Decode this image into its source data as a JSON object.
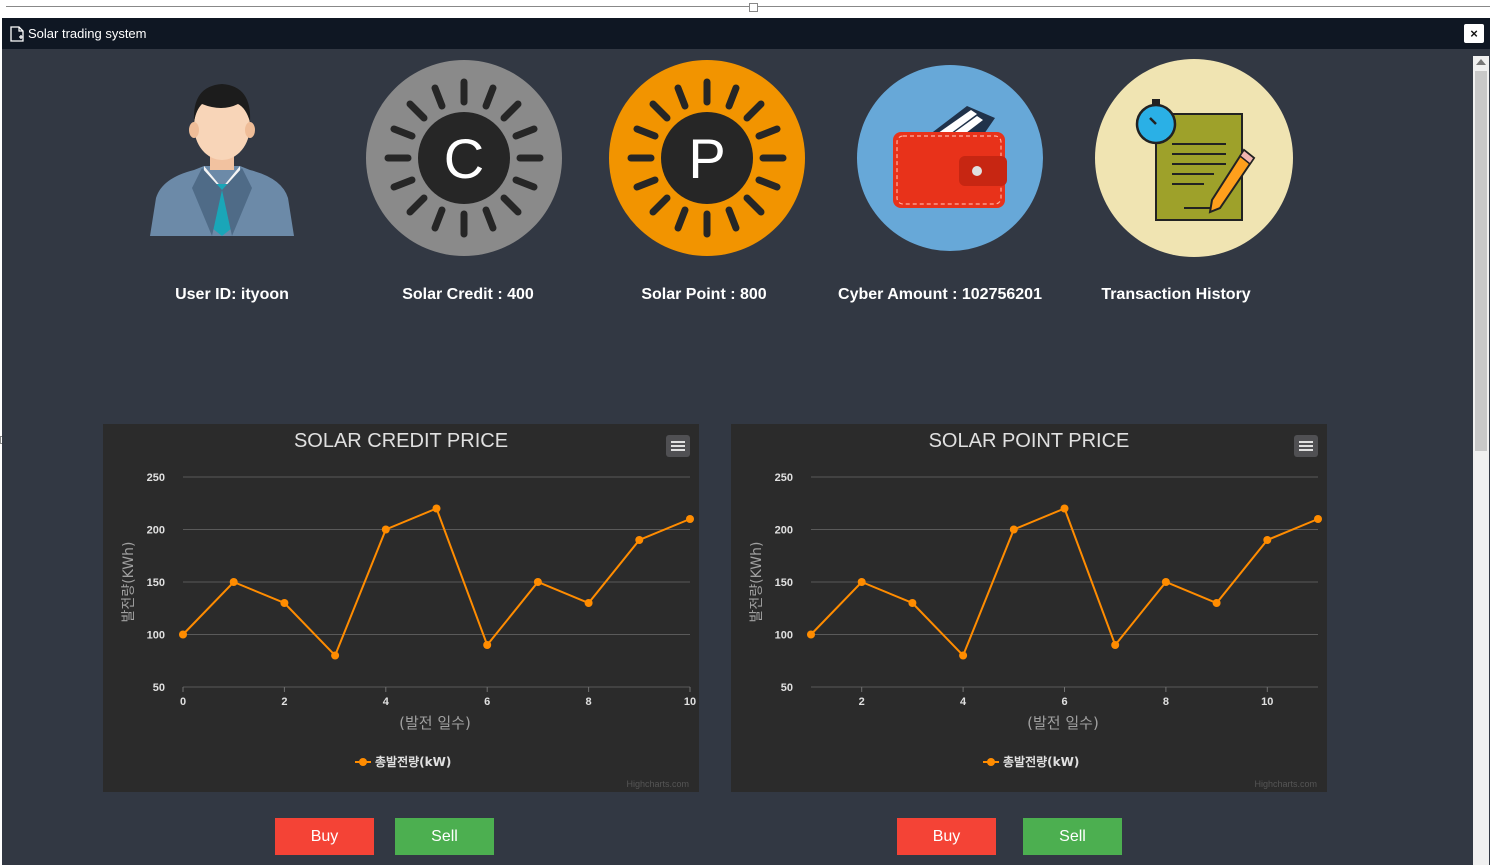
{
  "window": {
    "title": "Solar trading system",
    "close_label": "×"
  },
  "profile": [
    {
      "label": "User ID: ityoon",
      "icon": "user-avatar-icon"
    },
    {
      "label": "Solar Credit : 400",
      "icon": "solar-credit-icon",
      "glyph": "C"
    },
    {
      "label": "Solar Point : 800",
      "icon": "solar-point-icon",
      "glyph": "P"
    },
    {
      "label": "Cyber Amount : 102756201",
      "icon": "wallet-icon"
    },
    {
      "label": "Transaction History",
      "icon": "transaction-history-icon"
    }
  ],
  "buttons": {
    "buy": "Buy",
    "sell": "Sell"
  },
  "colors": {
    "buy": "#f44336",
    "sell": "#4caf50",
    "series": "#ff8c00",
    "background": "#323843"
  },
  "chart_data": [
    {
      "type": "line",
      "title": "SOLAR CREDIT PRICE",
      "xlabel": "(발전 일수)",
      "ylabel": "발전량(KWh)",
      "x": [
        0,
        1,
        2,
        3,
        4,
        5,
        6,
        7,
        8,
        9,
        10
      ],
      "x_ticks": [
        0,
        2,
        4,
        6,
        8,
        10
      ],
      "y_ticks": [
        50,
        100,
        150,
        200,
        250
      ],
      "xlim": [
        0,
        10
      ],
      "ylim": [
        50,
        250
      ],
      "series": [
        {
          "name": "총발전량(kW)",
          "values": [
            100,
            150,
            130,
            80,
            200,
            220,
            90,
            150,
            130,
            190,
            210
          ]
        }
      ],
      "legend": "bottom-center",
      "grid": true,
      "credits": "Highcharts.com"
    },
    {
      "type": "line",
      "title": "SOLAR POINT PRICE",
      "xlabel": "(발전 일수)",
      "ylabel": "발전량(KWh)",
      "x": [
        1,
        2,
        3,
        4,
        5,
        6,
        7,
        8,
        9,
        10,
        11
      ],
      "x_ticks": [
        2,
        4,
        6,
        8,
        10
      ],
      "y_ticks": [
        50,
        100,
        150,
        200,
        250
      ],
      "xlim": [
        1,
        11
      ],
      "ylim": [
        50,
        250
      ],
      "series": [
        {
          "name": "총발전량(kW)",
          "values": [
            100,
            150,
            130,
            80,
            200,
            220,
            90,
            150,
            130,
            190,
            210
          ]
        }
      ],
      "legend": "bottom-center",
      "grid": true,
      "credits": "Highcharts.com"
    }
  ]
}
